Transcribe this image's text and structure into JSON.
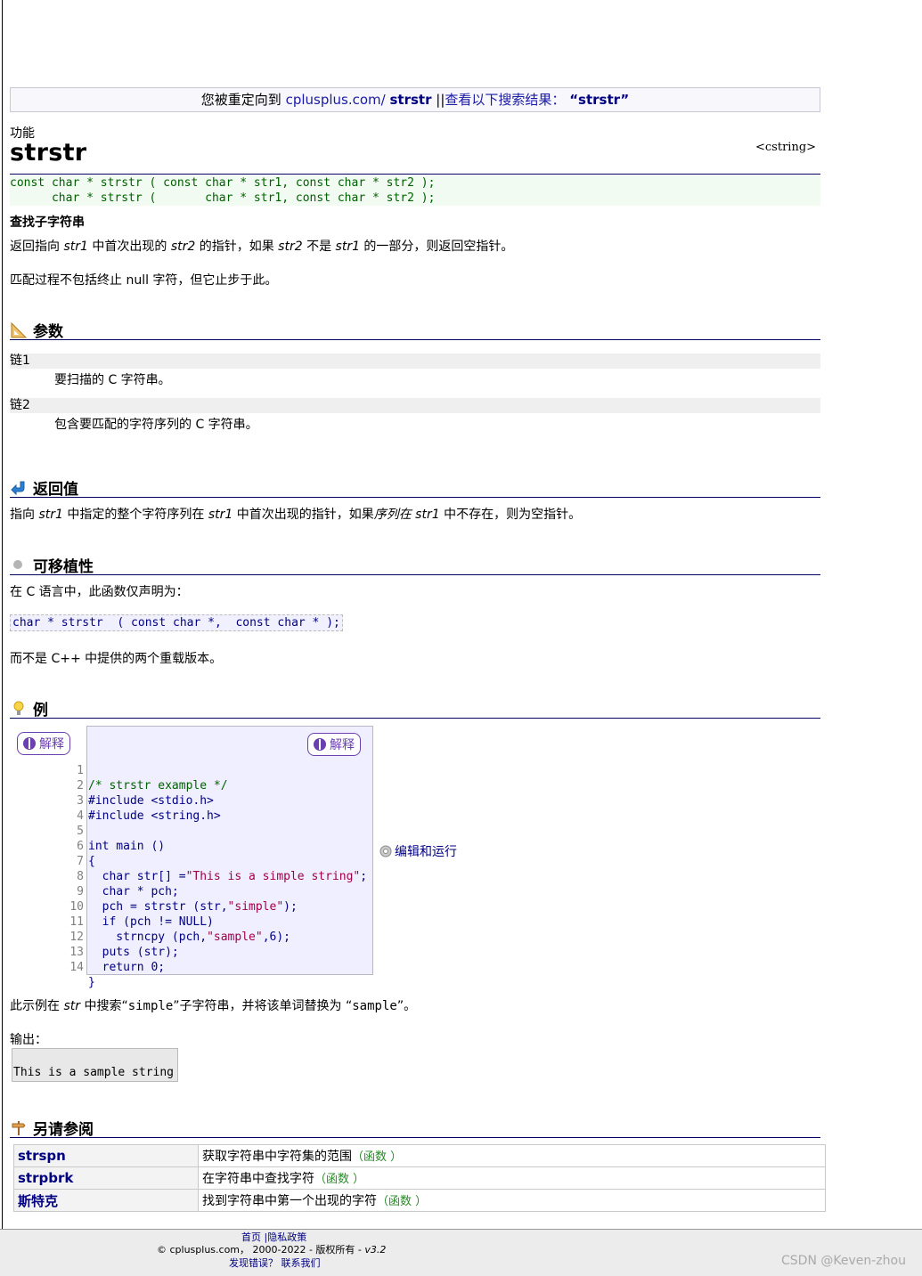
{
  "redirect": {
    "prefix": "您被重定向到 ",
    "site": "cplusplus.com/",
    "term": "strstr",
    "sep": " ||",
    "search": "查看以下搜索结果：",
    "query": "“strstr”"
  },
  "header": {
    "label": "功能",
    "title": "strstr",
    "include": "<cstring>"
  },
  "prototype": [
    "const char * strstr ( const char * str1, const char * str2 );",
    "      char * strstr (       char * str1, const char * str2 );"
  ],
  "summary": "查找子字符串",
  "description": {
    "line1_a": "返回指向 ",
    "line1_b": "str1",
    "line1_c": " 中首次出现的 ",
    "line1_d": "str2",
    "line1_e": " 的指针，如果 ",
    "line1_f": "str2",
    "line1_g": " 不是 ",
    "line1_h": "str1",
    "line1_i": " 的一部分，则返回空指针。",
    "line2": "匹配过程不包括终止 null 字符，但它止步于此。"
  },
  "params": {
    "heading": "参数",
    "p1_name": "链1",
    "p1_desc": "要扫描的 C 字符串。",
    "p2_name": "链2",
    "p2_desc": "包含要匹配的字符序列的 C 字符串。"
  },
  "return_value": {
    "heading": "返回值",
    "a": "指向 ",
    "b": "str1",
    "c": " 中指定的整个字符序列在 ",
    "d": "str1",
    "e": " 中首次出现的指针，如果",
    "f": "序列在 ",
    "g": "str1",
    "h": " 中不存在，则为空指针。"
  },
  "portability": {
    "heading": "可移植性",
    "intro": "在 C 语言中，此函数仅声明为：",
    "decl": "char * strstr  ( const char *,  const char * );",
    "note": "而不是 C++ 中提供的两个重载版本。"
  },
  "example": {
    "heading": "例",
    "explain_label": "解释",
    "explain_label2": "解释",
    "edit_run": "编辑和运行",
    "line_numbers": "1\n2\n3\n4\n5\n6\n7\n8\n9\n10\n11\n12\n13\n14",
    "code": {
      "l1": "/* strstr example */",
      "l2": "#include <stdio.h>",
      "l3": "#include <string.h>",
      "l5": "int main ()",
      "l6": "{",
      "l7a": "  char str[] =",
      "l7b": "\"This is a simple string\"",
      "l7c": ";",
      "l8": "  char * pch;",
      "l9a": "  pch = strstr (str,",
      "l9b": "\"simple\"",
      "l9c": ");",
      "l10": "  if (pch != NULL)",
      "l11a": "    strncpy (pch,",
      "l11b": "\"sample\"",
      "l11c": ",6);",
      "l12": "  puts (str);",
      "l13": "  return 0;",
      "l14": "}"
    },
    "desc_a": "此示例在 ",
    "desc_b": "str",
    "desc_c": " 中搜索“",
    "desc_d": "simple",
    "desc_e": "”子字符串，并将该单词替换为 “",
    "desc_f": "sample",
    "desc_g": "”。",
    "output_label": "输出：",
    "output": "This is a sample string"
  },
  "see_also": {
    "heading": "另请参阅",
    "rows": [
      {
        "name": "strspn",
        "desc": "获取字符串中字符集的范围",
        "kind": "（函数 ）"
      },
      {
        "name": "strpbrk",
        "desc": "在字符串中查找字符",
        "kind": "（函数 ）"
      },
      {
        "name": "斯特克",
        "desc": "找到字符串中第一个出现的字符",
        "kind": "（函数 ）"
      }
    ]
  },
  "footer": {
    "home": "首页",
    "sep": " |",
    "privacy": "隐私政策",
    "copyright": "© cplusplus.com， 2000-2022 - 版权所有 - ",
    "version": "v3.2",
    "bug": "发现错误？",
    "contact": "联系我们"
  },
  "watermark": "CSDN @Keven-zhou",
  "colors": {
    "link": "#000080",
    "prototype_bg": "#f1fbf1",
    "code_panel_bg": "#f0efff",
    "explain_accent": "#6a3fb0",
    "comment": "#006000",
    "string": "#a0004a"
  }
}
